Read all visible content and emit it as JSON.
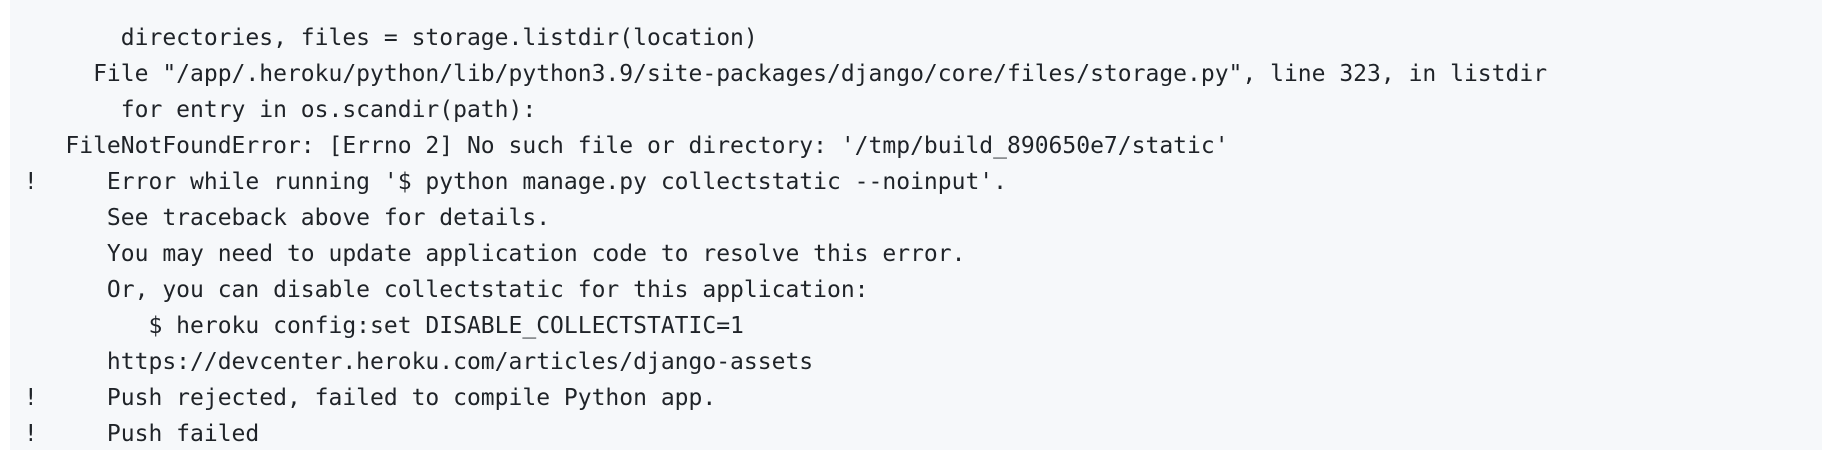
{
  "code_block": {
    "lines": [
      "        directories, files = storage.listdir(location)",
      "      File \"/app/.heroku/python/lib/python3.9/site-packages/django/core/files/storage.py\", line 323, in listdir",
      "        for entry in os.scandir(path):",
      "    FileNotFoundError: [Errno 2] No such file or directory: '/tmp/build_890650e7/static'",
      " !     Error while running '$ python manage.py collectstatic --noinput'.",
      "       See traceback above for details.",
      "       You may need to update application code to resolve this error.",
      "       Or, you can disable collectstatic for this application:",
      "          $ heroku config:set DISABLE_COLLECTSTATIC=1",
      "       https://devcenter.heroku.com/articles/django-assets",
      " !     Push rejected, failed to compile Python app.",
      " !     Push failed"
    ]
  }
}
